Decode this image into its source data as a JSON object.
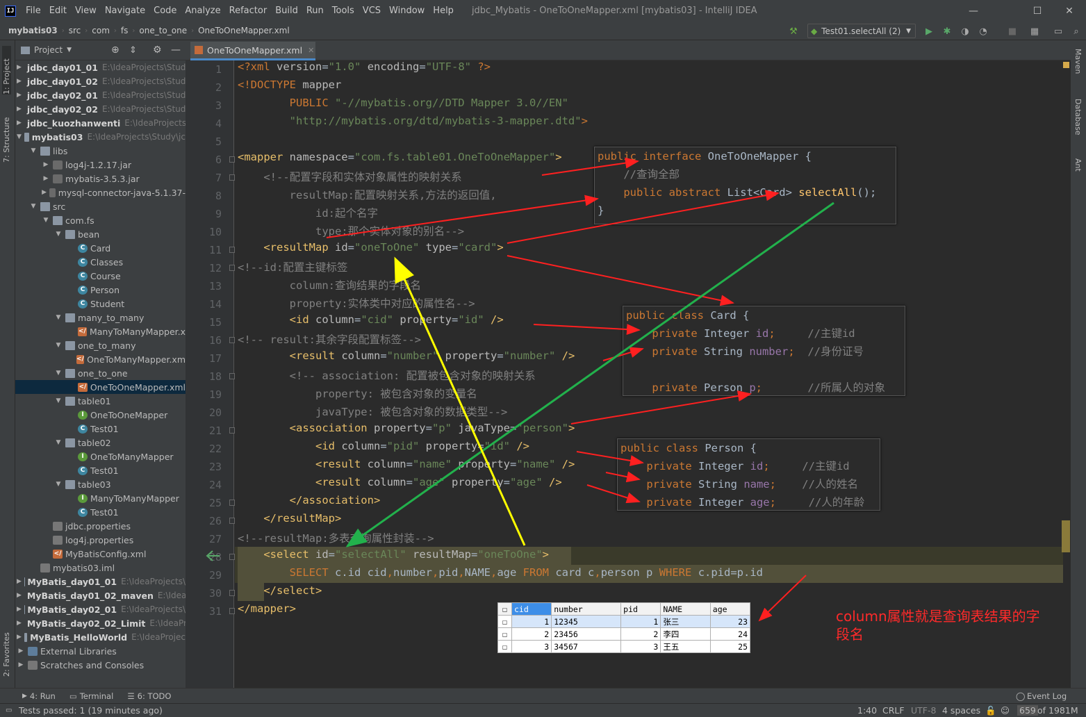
{
  "window": {
    "title": "jdbc_Mybatis - OneToOneMapper.xml [mybatis03] - IntelliJ IDEA"
  },
  "menu": [
    "File",
    "Edit",
    "View",
    "Navigate",
    "Code",
    "Analyze",
    "Refactor",
    "Build",
    "Run",
    "Tools",
    "VCS",
    "Window",
    "Help"
  ],
  "breadcrumb": [
    "mybatis03",
    "src",
    "com",
    "fs",
    "one_to_one",
    "OneToOneMapper.xml"
  ],
  "run_config": "Test01.selectAll (2)",
  "project_panel": {
    "title": "Project"
  },
  "tree": [
    {
      "name": "jdbc_day01_01",
      "path": "E:\\IdeaProjects\\Stud",
      "bold": true,
      "indent": 0,
      "arrow": "▶",
      "icon": "folder"
    },
    {
      "name": "jdbc_day01_02",
      "path": "E:\\IdeaProjects\\Stud",
      "bold": true,
      "indent": 0,
      "arrow": "▶",
      "icon": "folder"
    },
    {
      "name": "jdbc_day02_01",
      "path": "E:\\IdeaProjects\\Stud",
      "bold": true,
      "indent": 0,
      "arrow": "▶",
      "icon": "folder"
    },
    {
      "name": "jdbc_day02_02",
      "path": "E:\\IdeaProjects\\Stud",
      "bold": true,
      "indent": 0,
      "arrow": "▶",
      "icon": "folder"
    },
    {
      "name": "jdbc_kuozhanwenti",
      "path": "E:\\IdeaProjects",
      "bold": true,
      "indent": 0,
      "arrow": "▶",
      "icon": "folder"
    },
    {
      "name": "mybatis03",
      "path": "E:\\IdeaProjects\\Study\\jc",
      "bold": true,
      "indent": 0,
      "arrow": "▼",
      "icon": "folder"
    },
    {
      "name": "libs",
      "path": "",
      "bold": false,
      "indent": 1,
      "arrow": "▼",
      "icon": "folder"
    },
    {
      "name": "log4j-1.2.17.jar",
      "path": "",
      "bold": false,
      "indent": 2,
      "arrow": "▶",
      "icon": "jar"
    },
    {
      "name": "mybatis-3.5.3.jar",
      "path": "",
      "bold": false,
      "indent": 2,
      "arrow": "▶",
      "icon": "jar"
    },
    {
      "name": "mysql-connector-java-5.1.37-",
      "path": "",
      "bold": false,
      "indent": 2,
      "arrow": "▶",
      "icon": "jar"
    },
    {
      "name": "src",
      "path": "",
      "bold": false,
      "indent": 1,
      "arrow": "▼",
      "icon": "folder"
    },
    {
      "name": "com.fs",
      "path": "",
      "bold": false,
      "indent": 2,
      "arrow": "▼",
      "icon": "folder"
    },
    {
      "name": "bean",
      "path": "",
      "bold": false,
      "indent": 3,
      "arrow": "▼",
      "icon": "folder"
    },
    {
      "name": "Card",
      "path": "",
      "bold": false,
      "indent": 4,
      "arrow": "",
      "icon": "cls"
    },
    {
      "name": "Classes",
      "path": "",
      "bold": false,
      "indent": 4,
      "arrow": "",
      "icon": "cls"
    },
    {
      "name": "Course",
      "path": "",
      "bold": false,
      "indent": 4,
      "arrow": "",
      "icon": "cls"
    },
    {
      "name": "Person",
      "path": "",
      "bold": false,
      "indent": 4,
      "arrow": "",
      "icon": "cls"
    },
    {
      "name": "Student",
      "path": "",
      "bold": false,
      "indent": 4,
      "arrow": "",
      "icon": "cls"
    },
    {
      "name": "many_to_many",
      "path": "",
      "bold": false,
      "indent": 3,
      "arrow": "▼",
      "icon": "folder"
    },
    {
      "name": "ManyToManyMapper.x",
      "path": "",
      "bold": false,
      "indent": 4,
      "arrow": "",
      "icon": "xml"
    },
    {
      "name": "one_to_many",
      "path": "",
      "bold": false,
      "indent": 3,
      "arrow": "▼",
      "icon": "folder"
    },
    {
      "name": "OneToManyMapper.xm",
      "path": "",
      "bold": false,
      "indent": 4,
      "arrow": "",
      "icon": "xml"
    },
    {
      "name": "one_to_one",
      "path": "",
      "bold": false,
      "indent": 3,
      "arrow": "▼",
      "icon": "folder"
    },
    {
      "name": "OneToOneMapper.xml",
      "path": "",
      "bold": false,
      "indent": 4,
      "arrow": "",
      "icon": "xml",
      "selected": true
    },
    {
      "name": "table01",
      "path": "",
      "bold": false,
      "indent": 3,
      "arrow": "▼",
      "icon": "folder"
    },
    {
      "name": "OneToOneMapper",
      "path": "",
      "bold": false,
      "indent": 4,
      "arrow": "",
      "icon": "iface"
    },
    {
      "name": "Test01",
      "path": "",
      "bold": false,
      "indent": 4,
      "arrow": "",
      "icon": "test"
    },
    {
      "name": "table02",
      "path": "",
      "bold": false,
      "indent": 3,
      "arrow": "▼",
      "icon": "folder"
    },
    {
      "name": "OneToManyMapper",
      "path": "",
      "bold": false,
      "indent": 4,
      "arrow": "",
      "icon": "iface"
    },
    {
      "name": "Test01",
      "path": "",
      "bold": false,
      "indent": 4,
      "arrow": "",
      "icon": "test"
    },
    {
      "name": "table03",
      "path": "",
      "bold": false,
      "indent": 3,
      "arrow": "▼",
      "icon": "folder"
    },
    {
      "name": "ManyToManyMapper",
      "path": "",
      "bold": false,
      "indent": 4,
      "arrow": "",
      "icon": "iface"
    },
    {
      "name": "Test01",
      "path": "",
      "bold": false,
      "indent": 4,
      "arrow": "",
      "icon": "test"
    },
    {
      "name": "jdbc.properties",
      "path": "",
      "bold": false,
      "indent": 2,
      "arrow": "",
      "icon": "props"
    },
    {
      "name": "log4j.properties",
      "path": "",
      "bold": false,
      "indent": 2,
      "arrow": "",
      "icon": "props"
    },
    {
      "name": "MyBatisConfig.xml",
      "path": "",
      "bold": false,
      "indent": 2,
      "arrow": "",
      "icon": "xml"
    },
    {
      "name": "mybatis03.iml",
      "path": "",
      "bold": false,
      "indent": 1,
      "arrow": "",
      "icon": "props"
    },
    {
      "name": "MyBatis_day01_01",
      "path": "E:\\IdeaProjects\\",
      "bold": true,
      "indent": 0,
      "arrow": "▶",
      "icon": "folder"
    },
    {
      "name": "MyBatis_day01_02_maven",
      "path": "E:\\IdeaI",
      "bold": true,
      "indent": 0,
      "arrow": "▶",
      "icon": "folder"
    },
    {
      "name": "MyBatis_day02_01",
      "path": "E:\\IdeaProjects\\",
      "bold": true,
      "indent": 0,
      "arrow": "▶",
      "icon": "folder"
    },
    {
      "name": "MyBatis_day02_02_Limit",
      "path": "E:\\IdeaPr",
      "bold": true,
      "indent": 0,
      "arrow": "▶",
      "icon": "folder"
    },
    {
      "name": "MyBatis_HelloWorld",
      "path": "E:\\IdeaProjec",
      "bold": true,
      "indent": 0,
      "arrow": "▶",
      "icon": "folder"
    },
    {
      "name": "External Libraries",
      "path": "",
      "bold": false,
      "indent": 0,
      "arrow": "▶",
      "icon": "lib"
    },
    {
      "name": "Scratches and Consoles",
      "path": "",
      "bold": false,
      "indent": 0,
      "arrow": "▶",
      "icon": "props"
    }
  ],
  "editor_tab": "OneToOneMapper.xml",
  "code_lines": [
    [
      [
        "k",
        "<?xml "
      ],
      [
        "a",
        "version"
      ],
      [
        "n",
        "="
      ],
      [
        "v",
        "\"1.0\""
      ],
      [
        "n",
        " "
      ],
      [
        "a",
        "encoding"
      ],
      [
        "n",
        "="
      ],
      [
        "v",
        "\"UTF-8\""
      ],
      [
        "k",
        " ?>"
      ]
    ],
    [
      [
        "k",
        "<!DOCTYPE "
      ],
      [
        "a",
        "mapper"
      ]
    ],
    [
      [
        "k",
        "        PUBLIC "
      ],
      [
        "v",
        "\"-//mybatis.org//DTD Mapper 3.0//EN\""
      ]
    ],
    [
      [
        "v",
        "        \"http://mybatis.org/dtd/mybatis-3-mapper.dtd\""
      ],
      [
        "k",
        ">"
      ]
    ],
    [],
    [
      [
        "t",
        "<mapper "
      ],
      [
        "a",
        "namespace"
      ],
      [
        "n",
        "="
      ],
      [
        "v",
        "\"com.fs.table01.OneToOneMapper\""
      ],
      [
        "t",
        ">"
      ]
    ],
    [
      [
        "c",
        "    <!--配置字段和实体对象属性的映射关系"
      ]
    ],
    [
      [
        "c",
        "        resultMap:配置映射关系,方法的返回值,"
      ]
    ],
    [
      [
        "c",
        "            id:起个名字"
      ]
    ],
    [
      [
        "c",
        "            type:那个实体对象的别名-->"
      ]
    ],
    [
      [
        "t",
        "    <resultMap "
      ],
      [
        "a",
        "id"
      ],
      [
        "n",
        "="
      ],
      [
        "v",
        "\"oneToOne\""
      ],
      [
        "n",
        " "
      ],
      [
        "a",
        "type"
      ],
      [
        "n",
        "="
      ],
      [
        "v",
        "\"card\""
      ],
      [
        "t",
        ">"
      ]
    ],
    [
      [
        "c",
        "<!--id:配置主键标签"
      ]
    ],
    [
      [
        "c",
        "        column:查询结果的字段名"
      ]
    ],
    [
      [
        "c",
        "        property:实体类中对应的属性名-->"
      ]
    ],
    [
      [
        "t",
        "        <id "
      ],
      [
        "a",
        "column"
      ],
      [
        "n",
        "="
      ],
      [
        "v",
        "\"cid\""
      ],
      [
        "n",
        " "
      ],
      [
        "a",
        "property"
      ],
      [
        "n",
        "="
      ],
      [
        "v",
        "\"id\""
      ],
      [
        "t",
        " />"
      ]
    ],
    [
      [
        "c",
        "<!-- result:其余字段配置标签-->"
      ]
    ],
    [
      [
        "t",
        "        <result "
      ],
      [
        "a",
        "column"
      ],
      [
        "n",
        "="
      ],
      [
        "v",
        "\"number\""
      ],
      [
        "n",
        " "
      ],
      [
        "a",
        "property"
      ],
      [
        "n",
        "="
      ],
      [
        "v",
        "\"number\""
      ],
      [
        "t",
        " />"
      ]
    ],
    [
      [
        "c",
        "        <!-- association: 配置被包含对象的映射关系"
      ]
    ],
    [
      [
        "c",
        "            property: 被包含对象的变量名"
      ]
    ],
    [
      [
        "c",
        "            javaType: 被包含对象的数据类型-->"
      ]
    ],
    [
      [
        "t",
        "        <association "
      ],
      [
        "a",
        "property"
      ],
      [
        "n",
        "="
      ],
      [
        "v",
        "\"p\""
      ],
      [
        "n",
        " "
      ],
      [
        "a",
        "javaType"
      ],
      [
        "n",
        "="
      ],
      [
        "v",
        "\"person\""
      ],
      [
        "t",
        ">"
      ]
    ],
    [
      [
        "t",
        "            <id "
      ],
      [
        "a",
        "column"
      ],
      [
        "n",
        "="
      ],
      [
        "v",
        "\"pid\""
      ],
      [
        "n",
        " "
      ],
      [
        "a",
        "property"
      ],
      [
        "n",
        "="
      ],
      [
        "v",
        "\"id\""
      ],
      [
        "t",
        " />"
      ]
    ],
    [
      [
        "t",
        "            <result "
      ],
      [
        "a",
        "column"
      ],
      [
        "n",
        "="
      ],
      [
        "v",
        "\"name\""
      ],
      [
        "n",
        " "
      ],
      [
        "a",
        "property"
      ],
      [
        "n",
        "="
      ],
      [
        "v",
        "\"name\""
      ],
      [
        "t",
        " />"
      ]
    ],
    [
      [
        "t",
        "            <result "
      ],
      [
        "a",
        "column"
      ],
      [
        "n",
        "="
      ],
      [
        "v",
        "\"age\""
      ],
      [
        "n",
        " "
      ],
      [
        "a",
        "property"
      ],
      [
        "n",
        "="
      ],
      [
        "v",
        "\"age\""
      ],
      [
        "t",
        " />"
      ]
    ],
    [
      [
        "t",
        "        </association>"
      ]
    ],
    [
      [
        "t",
        "    </resultMap>"
      ]
    ],
    [
      [
        "c",
        "<!--resultMap:多表查询属性封装-->"
      ]
    ],
    [
      [
        "t",
        "    <select "
      ],
      [
        "a",
        "id"
      ],
      [
        "n",
        "="
      ],
      [
        "v",
        "\"selectAll\""
      ],
      [
        "n",
        " "
      ],
      [
        "a",
        "resultMap"
      ],
      [
        "n",
        "="
      ],
      [
        "v",
        "\"oneToOne\""
      ],
      [
        "t",
        ">"
      ]
    ],
    [
      [
        "k",
        "        SELECT "
      ],
      [
        "n",
        "c.id cid"
      ],
      [
        "k",
        ","
      ],
      [
        "n",
        "number"
      ],
      [
        "k",
        ","
      ],
      [
        "n",
        "pid"
      ],
      [
        "k",
        ","
      ],
      [
        "n",
        "NAME"
      ],
      [
        "k",
        ","
      ],
      [
        "n",
        "age "
      ],
      [
        "k",
        "FROM "
      ],
      [
        "n",
        "card c"
      ],
      [
        "k",
        ","
      ],
      [
        "n",
        "person p "
      ],
      [
        "k",
        "WHERE "
      ],
      [
        "n",
        "c.pid=p.id"
      ]
    ],
    [
      [
        "t",
        "    </select>"
      ]
    ],
    [
      [
        "t",
        "</mapper>"
      ]
    ]
  ],
  "ann_interface": [
    [
      [
        "k",
        "public "
      ],
      [
        "k",
        "interface "
      ],
      [
        "n",
        "OneToOneMapper {"
      ]
    ],
    [
      [
        "c",
        "    //查询全部"
      ]
    ],
    [
      [
        "k",
        "    public abstract "
      ],
      [
        "n",
        "List<Card> "
      ],
      [
        "f",
        "selectAll"
      ],
      [
        "n",
        "();"
      ]
    ],
    [
      [
        "n",
        "}"
      ]
    ]
  ],
  "ann_card": [
    [
      [
        "k",
        "public "
      ],
      [
        "k",
        "class "
      ],
      [
        "n",
        "Card {"
      ]
    ],
    [
      [
        "k",
        "    private "
      ],
      [
        "n",
        "Integer "
      ],
      [
        "p",
        "id"
      ],
      [
        "k",
        ";"
      ],
      [
        "c",
        "     //主键id"
      ]
    ],
    [
      [
        "k",
        "    private "
      ],
      [
        "n",
        "String "
      ],
      [
        "p",
        "number"
      ],
      [
        "k",
        ";"
      ],
      [
        "c",
        "  //身份证号"
      ]
    ],
    [],
    [
      [
        "k",
        "    private "
      ],
      [
        "n",
        "Person "
      ],
      [
        "p",
        "p"
      ],
      [
        "k",
        ";"
      ],
      [
        "c",
        "       //所属人的对象"
      ]
    ]
  ],
  "ann_person": [
    [
      [
        "k",
        "public "
      ],
      [
        "k",
        "class "
      ],
      [
        "n",
        "Person {"
      ]
    ],
    [
      [
        "k",
        "    private "
      ],
      [
        "n",
        "Integer "
      ],
      [
        "p",
        "id"
      ],
      [
        "k",
        ";"
      ],
      [
        "c",
        "     //主键id"
      ]
    ],
    [
      [
        "k",
        "    private "
      ],
      [
        "n",
        "String "
      ],
      [
        "p",
        "name"
      ],
      [
        "k",
        ";"
      ],
      [
        "c",
        "    //人的姓名"
      ]
    ],
    [
      [
        "k",
        "    private "
      ],
      [
        "n",
        "Integer "
      ],
      [
        "p",
        "age"
      ],
      [
        "k",
        ";"
      ],
      [
        "c",
        "     //人的年龄"
      ]
    ]
  ],
  "result_table": {
    "columns": [
      "cid",
      "number",
      "pid",
      "NAME",
      "age"
    ],
    "rows": [
      [
        "1",
        "12345",
        "1",
        "张三",
        "23"
      ],
      [
        "2",
        "23456",
        "2",
        "李四",
        "24"
      ],
      [
        "3",
        "34567",
        "3",
        "王五",
        "25"
      ]
    ]
  },
  "annotation_note": "column属性就是查询表结果的字段名",
  "tool_windows": {
    "left": [
      "1: Project",
      "7: Structure",
      "2: Favorites"
    ],
    "right": [
      "Maven",
      "Database",
      "Ant"
    ]
  },
  "bottom_tools": [
    "4: Run",
    "Terminal",
    "6: TODO"
  ],
  "event_log": "Event Log",
  "status": {
    "message": "Tests passed: 1 (19 minutes ago)",
    "position": "1:40",
    "line_sep": "CRLF",
    "encoding": "UTF-8",
    "indent": "4 spaces",
    "memory_used": "659",
    "memory_total": "of 1981M"
  },
  "colors": {
    "keyword": "#cc7832",
    "string": "#6a8759",
    "tag": "#e8bf6a",
    "comment": "#808080",
    "method": "#ffc66d",
    "field": "#9876aa",
    "arrow_red": "#ff2020",
    "arrow_green": "#22b14c",
    "arrow_yellow": "#ffff00"
  }
}
